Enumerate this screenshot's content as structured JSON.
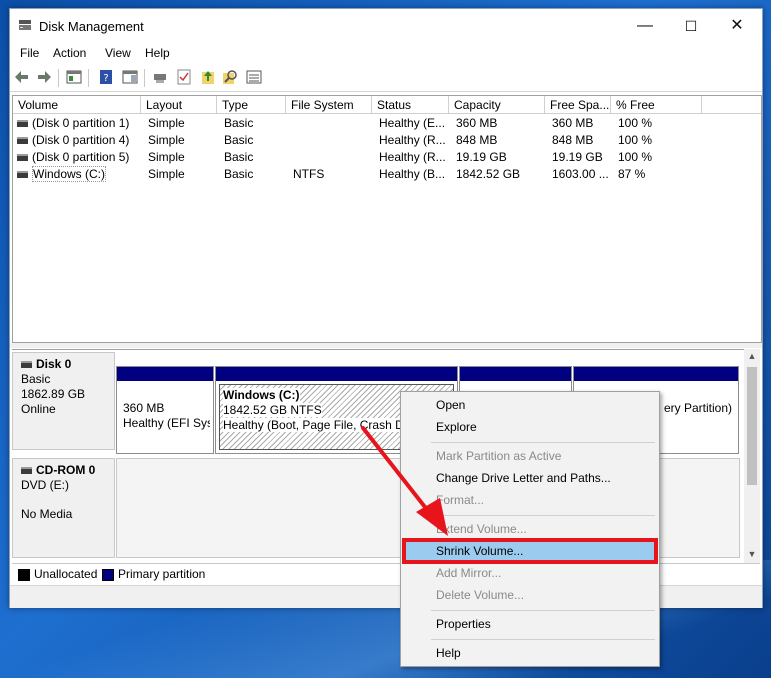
{
  "window": {
    "title": "Disk Management",
    "minimize": "—",
    "maximize": "☐",
    "close": "✕"
  },
  "menu": [
    "File",
    "Action",
    "View",
    "Help"
  ],
  "columns": [
    "Volume",
    "Layout",
    "Type",
    "File System",
    "Status",
    "Capacity",
    "Free Spa...",
    "% Free"
  ],
  "volumes": [
    {
      "volume": "(Disk 0 partition 1)",
      "layout": "Simple",
      "type": "Basic",
      "fs": "",
      "status": "Healthy (E...",
      "capacity": "360 MB",
      "free": "360 MB",
      "pct": "100 %"
    },
    {
      "volume": "(Disk 0 partition 4)",
      "layout": "Simple",
      "type": "Basic",
      "fs": "",
      "status": "Healthy (R...",
      "capacity": "848 MB",
      "free": "848 MB",
      "pct": "100 %"
    },
    {
      "volume": "(Disk 0 partition 5)",
      "layout": "Simple",
      "type": "Basic",
      "fs": "",
      "status": "Healthy (R...",
      "capacity": "19.19 GB",
      "free": "19.19 GB",
      "pct": "100 %"
    },
    {
      "volume": "Windows (C:)",
      "layout": "Simple",
      "type": "Basic",
      "fs": "NTFS",
      "status": "Healthy (B...",
      "capacity": "1842.52 GB",
      "free": "1603.00 ...",
      "pct": "87 %"
    }
  ],
  "disk0": {
    "name": "Disk 0",
    "kind": "Basic",
    "size": "1862.89 GB",
    "state": "Online"
  },
  "cdrom": {
    "name": "CD-ROM 0",
    "kind": "DVD (E:)",
    "state": "No Media"
  },
  "partitions": {
    "efi": {
      "size": "360 MB",
      "status": "Healthy (EFI Sys"
    },
    "windows": {
      "name": "Windows  (C:)",
      "size": "1842.52 GB NTFS",
      "status": "Healthy (Boot, Page File, Crash Du"
    },
    "recovery": {
      "status": "ery Partition)"
    }
  },
  "legend": {
    "unallocated": "Unallocated",
    "primary": "Primary partition"
  },
  "context_menu": {
    "open": "Open",
    "explore": "Explore",
    "mark_active": "Mark Partition as Active",
    "change_letter": "Change Drive Letter and Paths...",
    "format": "Format...",
    "extend": "Extend Volume...",
    "shrink": "Shrink Volume...",
    "add_mirror": "Add Mirror...",
    "delete": "Delete Volume...",
    "properties": "Properties",
    "help": "Help"
  },
  "colors": {
    "partition_bar": "#000080",
    "highlight": "#9ccbf0",
    "annotation_red": "#e8141c"
  }
}
